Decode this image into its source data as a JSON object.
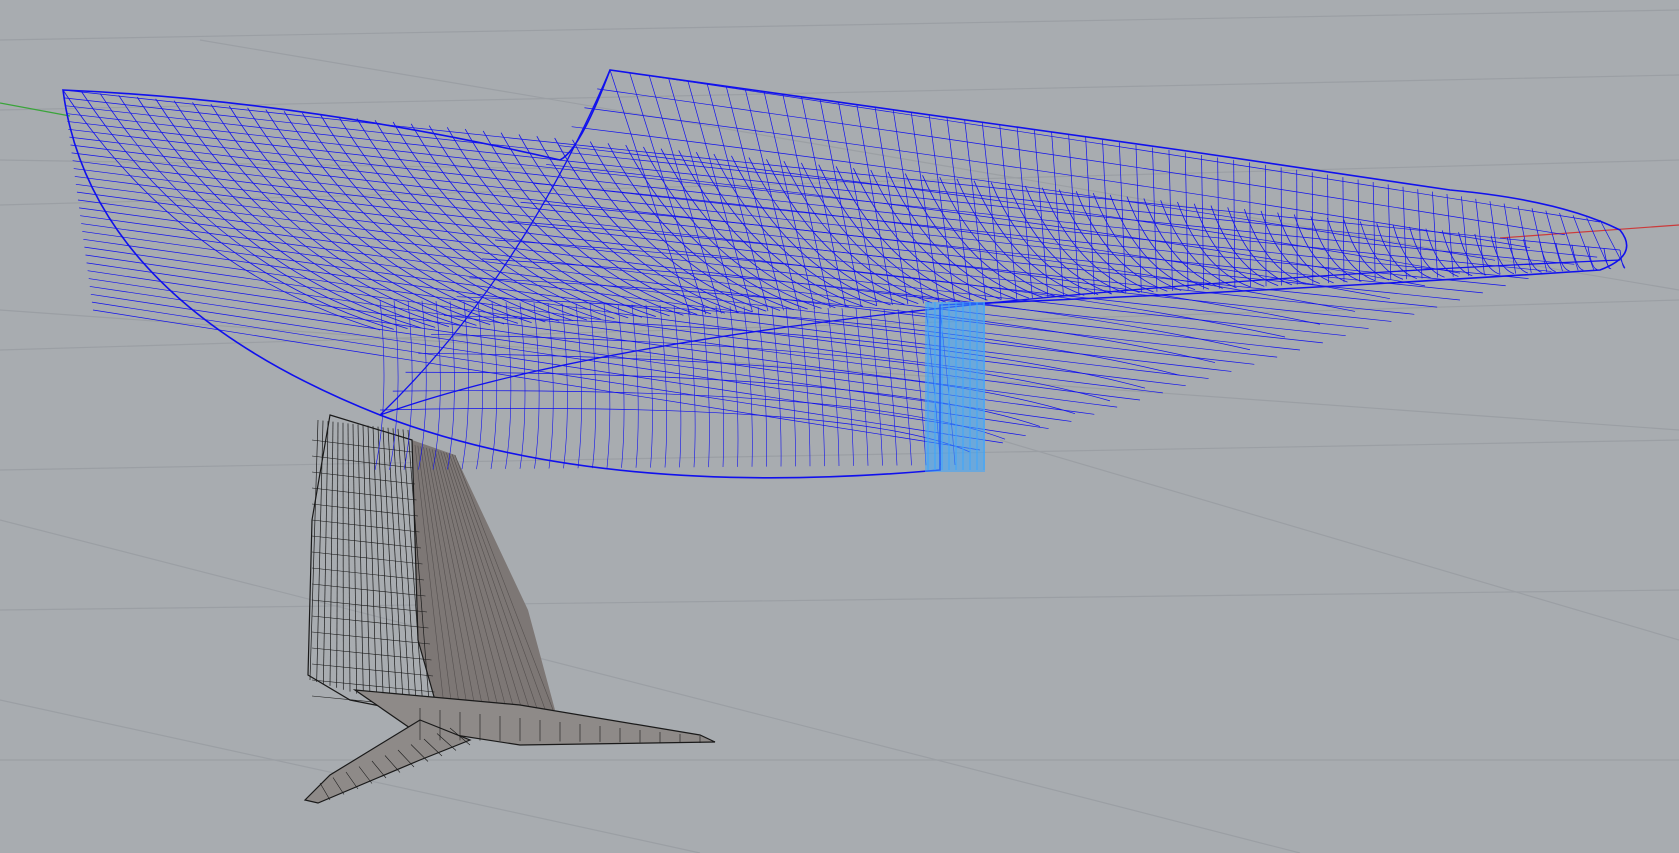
{
  "viewport": {
    "view": "perspective",
    "background": "#a8acb0",
    "grid": true,
    "grid_color": "#9b9fa4",
    "axis_x_color": "#cc3a3a",
    "axis_y_color": "#3aa43a"
  },
  "model": {
    "hull": {
      "color": "#1010ee",
      "transom_highlight": "#3aa6ff",
      "display": "wireframe"
    },
    "appendage": {
      "color": "#1a1a1a",
      "shaded_face": "#7d7775",
      "display": "wireframe"
    }
  }
}
